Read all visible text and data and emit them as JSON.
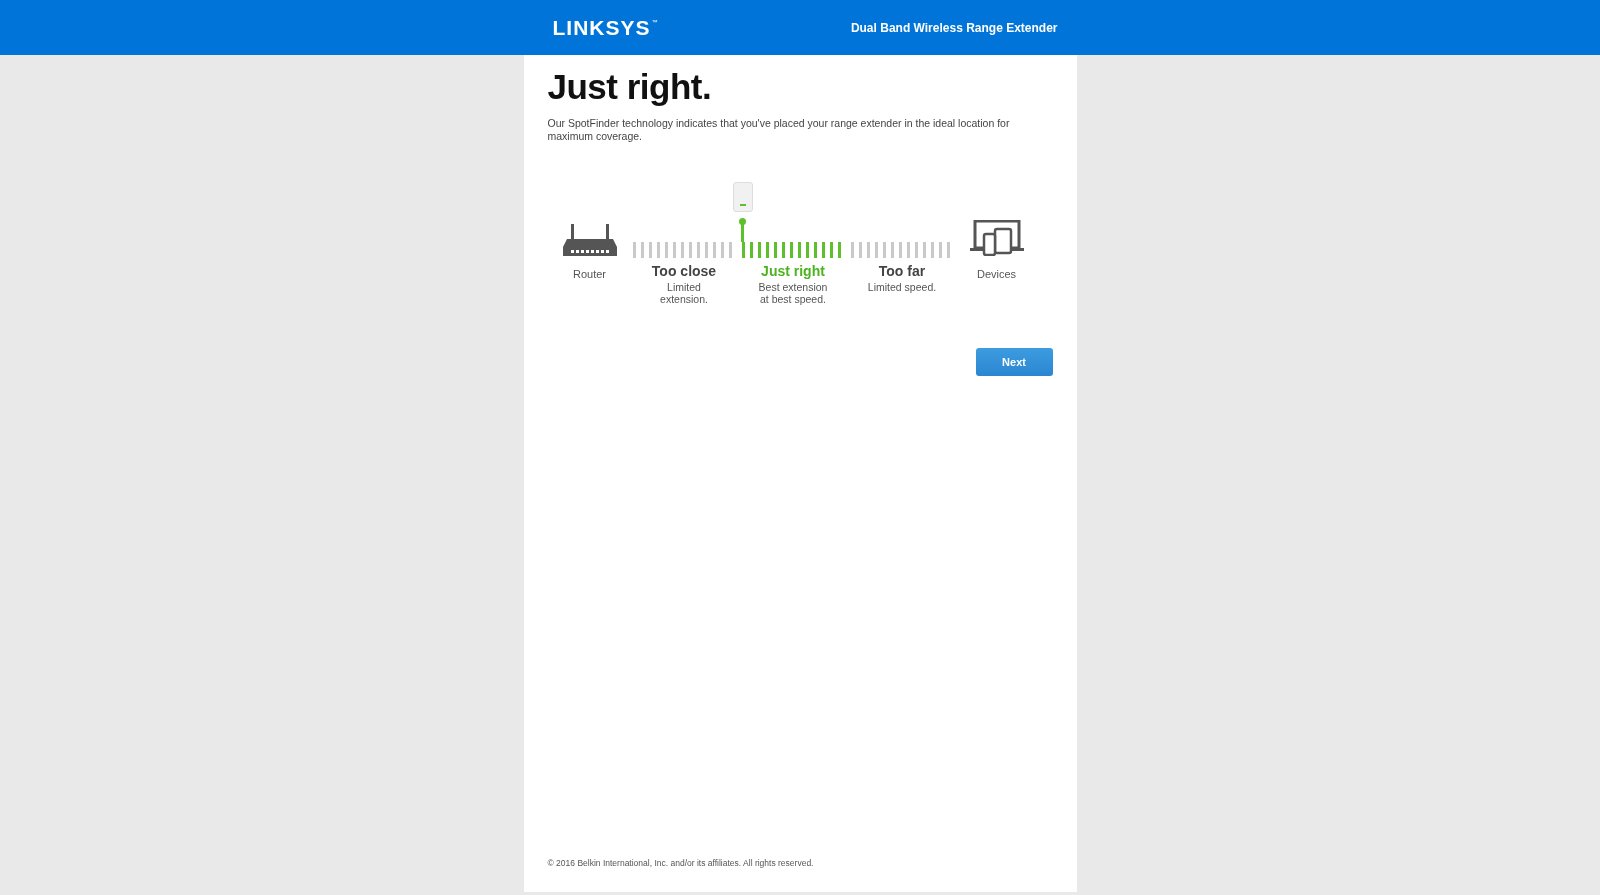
{
  "header": {
    "logo": "LINKSYS",
    "logo_mark": "™",
    "product": "Dual Band Wireless Range Extender"
  },
  "heading": "Just right.",
  "description": "Our SpotFinder technology indicates that you've placed your range extender in the ideal location for maximum coverage.",
  "spotfinder": [
    {
      "kind": "router",
      "label": "Router"
    },
    {
      "kind": "zone",
      "title": "Too close",
      "detail": "Limited\nextension.",
      "selected": false
    },
    {
      "kind": "zone",
      "title": "Just right",
      "detail": "Best extension\nat best speed.",
      "selected": true
    },
    {
      "kind": "zone",
      "title": "Too far",
      "detail": "Limited speed.",
      "selected": false
    },
    {
      "kind": "devices",
      "label": "Devices"
    }
  ],
  "next_button": "Next",
  "footer": "© 2016 Belkin International, Inc. and/or its affiliates. All rights reserved."
}
